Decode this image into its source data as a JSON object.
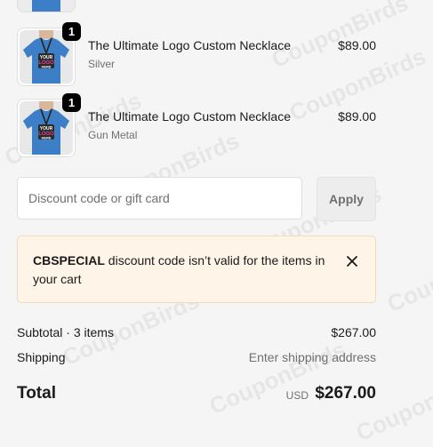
{
  "watermark": {
    "text": "CouponBirds"
  },
  "items": [
    {
      "title": "The Ultimate Logo Custom Necklace",
      "variant": "Silver",
      "price": "$89.00",
      "quantity": "1",
      "image_icon": "tshirt-necklace-product-image"
    },
    {
      "title": "The Ultimate Logo Custom Necklace",
      "variant": "Gun Metal",
      "price": "$89.00",
      "quantity": "1",
      "image_icon": "tshirt-necklace-product-image"
    }
  ],
  "discount": {
    "placeholder": "Discount code or gift card",
    "value": "",
    "apply_label": "Apply"
  },
  "error_banner": {
    "code": "CBSPECIAL",
    "message": " discount code isn’t valid for the items in your cart",
    "close_icon": "close-icon"
  },
  "summary": {
    "subtotal_label": "Subtotal · 3 items",
    "subtotal_value": "$267.00",
    "shipping_label": "Shipping",
    "shipping_value": "Enter shipping address",
    "total_label": "Total",
    "total_currency": "USD",
    "total_value": "$267.00"
  },
  "colors": {
    "background": "#f5f5f5",
    "banner_background": "#fff4e8",
    "banner_border": "#f5d9b4",
    "badge": "#000000",
    "shirt": "#3d7fc6"
  }
}
